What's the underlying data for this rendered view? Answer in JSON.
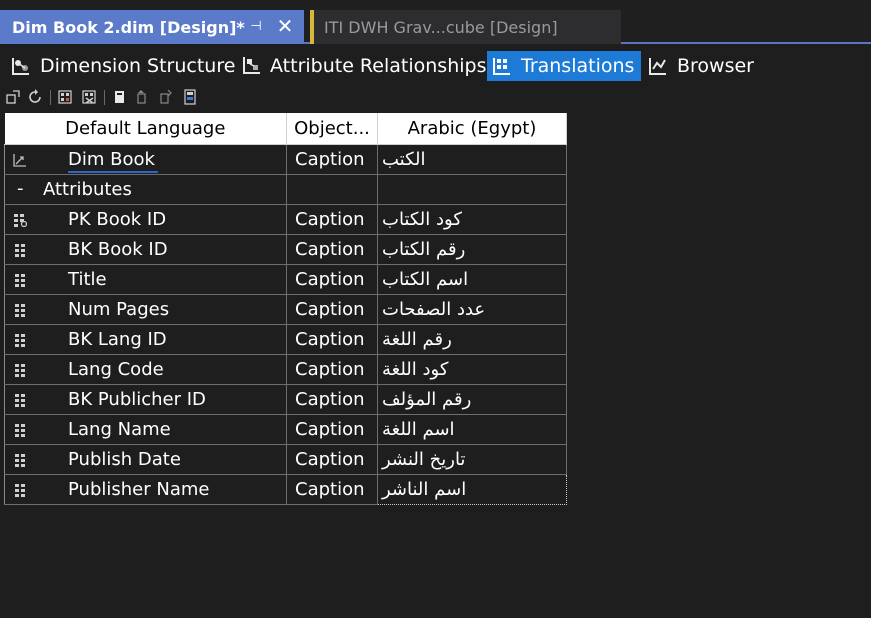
{
  "document_tabs": {
    "active": {
      "title": "Dim Book 2.dim [Design]*"
    },
    "inactive": {
      "title": "ITI DWH Grav...cube [Design]"
    }
  },
  "view_tabs": [
    {
      "label": "Dimension Structure",
      "icon": "dimension-structure-icon",
      "active": false
    },
    {
      "label": "Attribute Relationships",
      "icon": "attribute-relationships-icon",
      "active": false
    },
    {
      "label": "Translations",
      "icon": "translations-icon",
      "active": true
    },
    {
      "label": "Browser",
      "icon": "browser-icon",
      "active": false
    }
  ],
  "grid": {
    "headers": [
      "Default Language",
      "Object...",
      "Arabic (Egypt)"
    ],
    "dimension_row": {
      "name": "Dim Book",
      "object": "Caption",
      "translation": "الكتب"
    },
    "group_row": {
      "name": "Attributes"
    },
    "attribute_rows": [
      {
        "name": "PK Book ID",
        "object": "Caption",
        "translation": "كود الكتاب",
        "icon": "key-attribute-icon"
      },
      {
        "name": "BK Book ID",
        "object": "Caption",
        "translation": "رقم الكتاب",
        "icon": "attribute-icon"
      },
      {
        "name": "Title",
        "object": "Caption",
        "translation": "اسم الكتاب",
        "icon": "attribute-icon"
      },
      {
        "name": "Num Pages",
        "object": "Caption",
        "translation": "عدد الصفحات",
        "icon": "attribute-icon"
      },
      {
        "name": "BK Lang ID",
        "object": "Caption",
        "translation": "رقم اللغة",
        "icon": "attribute-icon"
      },
      {
        "name": "Lang Code",
        "object": "Caption",
        "translation": "كود اللغة",
        "icon": "attribute-icon"
      },
      {
        "name": "BK Publicher ID",
        "object": "Caption",
        "translation": "رقم المؤلف",
        "icon": "attribute-icon"
      },
      {
        "name": "Lang Name",
        "object": "Caption",
        "translation": "اسم اللغة",
        "icon": "attribute-icon"
      },
      {
        "name": "Publish Date",
        "object": "Caption",
        "translation": "تاريخ النشر",
        "icon": "attribute-icon"
      },
      {
        "name": "Publisher Name",
        "object": "Caption",
        "translation": "اسم الناشر",
        "icon": "attribute-icon"
      }
    ]
  },
  "colors": {
    "active_doc_tab": "#5b7ac9",
    "active_view_tab": "#1d7ad6",
    "inactive_tab_marker": "#d7b73a",
    "background": "#1e1e1e"
  }
}
